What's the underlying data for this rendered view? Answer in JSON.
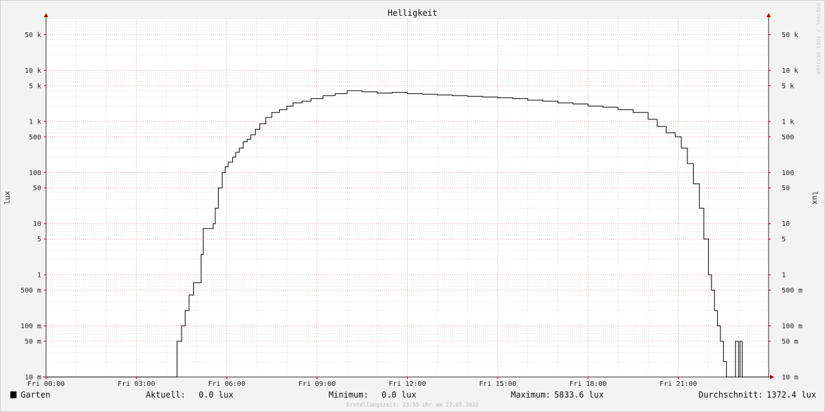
{
  "chart_data": {
    "type": "line",
    "title": "Helligkeit",
    "ylabel": "lux",
    "y_scale": "log",
    "ylim": [
      0.01,
      100000
    ],
    "xlim": [
      0,
      24
    ],
    "grid": true,
    "y_tick_values": [
      0.01,
      0.05,
      0.1,
      0.5,
      1,
      5,
      10,
      50,
      100,
      500,
      1000,
      5000,
      10000,
      50000
    ],
    "y_tick_labels": [
      "10 m",
      "50 m",
      "100 m",
      "500 m",
      "1",
      "5",
      "10",
      "50",
      "100",
      "500",
      "1 k",
      "5 k",
      "10 k",
      "50 k"
    ],
    "x_tick_values": [
      0,
      3,
      6,
      9,
      12,
      15,
      18,
      21
    ],
    "x_tick_labels": [
      "Fri 00:00",
      "Fri 03:00",
      "Fri 06:00",
      "Fri 09:00",
      "Fri 12:00",
      "Fri 15:00",
      "Fri 18:00",
      "Fri 21:00"
    ],
    "series": [
      {
        "name": "Garten",
        "color": "#000000",
        "x": [
          0,
          4.35,
          4.5,
          4.62,
          4.75,
          4.9,
          5.05,
          5.15,
          5.22,
          5.55,
          5.62,
          5.72,
          5.85,
          5.95,
          6.05,
          6.2,
          6.3,
          6.42,
          6.55,
          6.68,
          6.8,
          6.95,
          7.1,
          7.3,
          7.5,
          7.75,
          8.0,
          8.2,
          8.5,
          8.8,
          9.2,
          9.6,
          10.0,
          10.5,
          11.0,
          11.5,
          12.0,
          12.5,
          13.0,
          13.5,
          14.0,
          14.5,
          15.0,
          15.5,
          16.0,
          16.5,
          17.0,
          17.5,
          18.0,
          18.5,
          19.0,
          19.5,
          20.0,
          20.3,
          20.6,
          20.9,
          21.1,
          21.3,
          21.5,
          21.7,
          21.85,
          22.0,
          22.1,
          22.2,
          22.3,
          22.4,
          22.5,
          22.6,
          22.7,
          22.8,
          22.9,
          23.0,
          23.05,
          23.12,
          23.2,
          24.0
        ],
        "values": [
          0.01,
          0.05,
          0.1,
          0.2,
          0.4,
          0.7,
          0.7,
          2.5,
          8,
          10,
          20,
          50,
          100,
          130,
          160,
          200,
          250,
          300,
          400,
          450,
          550,
          700,
          900,
          1200,
          1500,
          1700,
          2000,
          2300,
          2500,
          2800,
          3200,
          3500,
          4000,
          3800,
          3600,
          3700,
          3500,
          3400,
          3300,
          3200,
          3100,
          3000,
          2900,
          2800,
          2600,
          2500,
          2300,
          2200,
          2000,
          1900,
          1700,
          1500,
          1100,
          800,
          600,
          500,
          300,
          150,
          60,
          20,
          5,
          1,
          0.5,
          0.2,
          0.1,
          0.05,
          0.02,
          0.01,
          0.01,
          0.01,
          0.05,
          0.01,
          0.05,
          0.01,
          0.01,
          0.01
        ]
      }
    ],
    "legend": {
      "swatch_color": "#000000",
      "label": "Garten",
      "current_label": "Aktuell:",
      "current_value": "0.0 lux",
      "min_label": "Minimum:",
      "min_value": "0.0 lux",
      "max_label": "Maximum:",
      "max_value": "5833.6 lux",
      "avg_label": "Durchschnitt:",
      "avg_value": "1372.4 lux"
    },
    "footer": "Erstellungszeit: 23:55 Uhr am 27.05.2022",
    "watermark": "RRDTOOL / TOBI OETIKER"
  }
}
